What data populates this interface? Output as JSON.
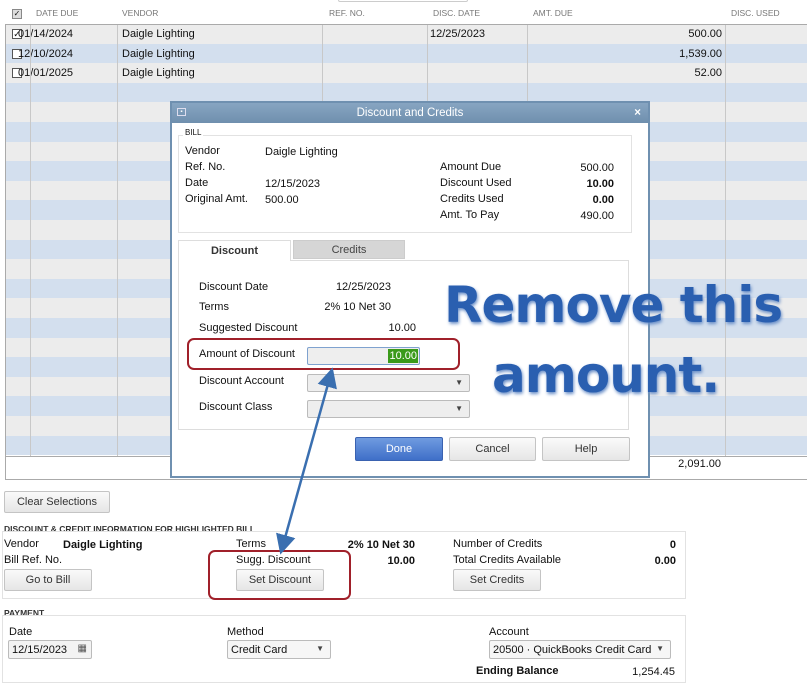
{
  "table": {
    "headers": [
      "DATE DUE",
      "VENDOR",
      "REF. NO.",
      "DISC. DATE",
      "AMT. DUE",
      "DISC. USED"
    ],
    "rows": [
      {
        "checked": true,
        "date_due": "01/14/2024",
        "vendor": "Daigle Lighting",
        "ref_no": "",
        "disc_date": "12/25/2023",
        "amt_due": "500.00",
        "disc_used": ""
      },
      {
        "checked": false,
        "date_due": "12/10/2024",
        "vendor": "Daigle Lighting",
        "ref_no": "",
        "disc_date": "",
        "amt_due": "1,539.00",
        "disc_used": ""
      },
      {
        "checked": false,
        "date_due": "01/01/2025",
        "vendor": "Daigle Lighting",
        "ref_no": "",
        "disc_date": "",
        "amt_due": "52.00",
        "disc_used": ""
      }
    ],
    "total_amt_due": "2,091.00"
  },
  "clear_selections": "Clear Selections",
  "info": {
    "section": "DISCOUNT & CREDIT INFORMATION FOR HIGHLIGHTED BILL",
    "vendor_label": "Vendor",
    "vendor": "Daigle Lighting",
    "bill_ref_label": "Bill Ref. No.",
    "terms_label": "Terms",
    "terms": "2% 10 Net 30",
    "sugg_label": "Sugg. Discount",
    "sugg": "10.00",
    "num_credits_label": "Number of Credits",
    "num_credits": "0",
    "total_credits_label": "Total Credits Available",
    "total_credits": "0.00",
    "go_to_bill": "Go to Bill",
    "set_discount": "Set Discount",
    "set_credits": "Set Credits"
  },
  "payment": {
    "section": "PAYMENT",
    "date_label": "Date",
    "date": "12/15/2023",
    "method_label": "Method",
    "method": "Credit Card",
    "account_label": "Account",
    "account": "20500 · QuickBooks Credit Card",
    "ending_label": "Ending Balance",
    "ending": "1,254.45"
  },
  "dialog": {
    "title": "Discount and Credits",
    "bill_section": "BILL",
    "vendor_label": "Vendor",
    "vendor": "Daigle Lighting",
    "ref_label": "Ref. No.",
    "date_label": "Date",
    "date": "12/15/2023",
    "orig_label": "Original Amt.",
    "orig": "500.00",
    "amt_due_label": "Amount Due",
    "amt_due": "500.00",
    "disc_used_label": "Discount Used",
    "disc_used": "10.00",
    "credits_used_label": "Credits Used",
    "credits_used": "0.00",
    "to_pay_label": "Amt. To Pay",
    "to_pay": "490.00",
    "tab_discount": "Discount",
    "tab_credits": "Credits",
    "disc_date_label": "Discount Date",
    "disc_date": "12/25/2023",
    "terms_label": "Terms",
    "terms": "2% 10 Net 30",
    "sugg_label": "Suggested Discount",
    "sugg": "10.00",
    "amount_label": "Amount of Discount",
    "amount": "10.00",
    "account_label": "Discount Account",
    "class_label": "Discount Class",
    "done": "Done",
    "cancel": "Cancel",
    "help": "Help"
  },
  "annotation": {
    "line1": "Remove this",
    "line2": "amount.",
    "color": "#2a5fb0",
    "highlight": "#a0202a"
  }
}
